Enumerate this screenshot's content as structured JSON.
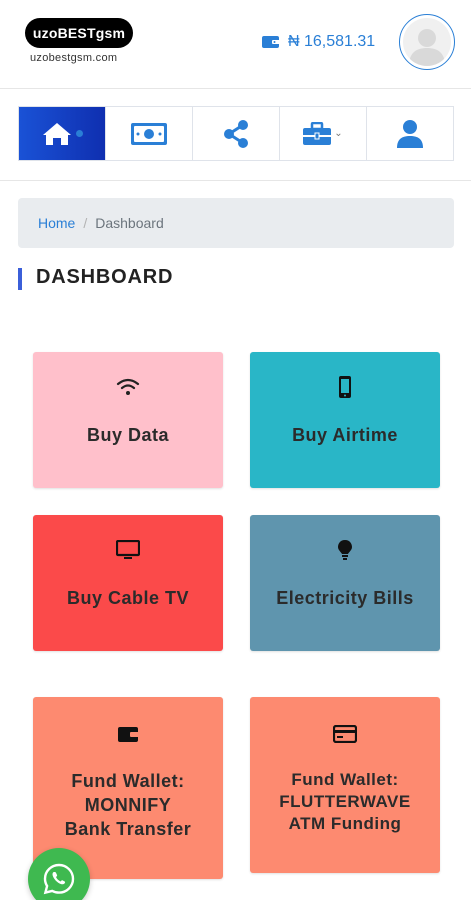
{
  "header": {
    "logo_text": "uzoBESTgsm",
    "logo_subtext": "uzobestgsm.com",
    "balance": "₦ 16,581.31"
  },
  "nav": {
    "items": [
      {
        "name": "home",
        "icon": "home-icon"
      },
      {
        "name": "money",
        "icon": "money-icon"
      },
      {
        "name": "share",
        "icon": "share-icon"
      },
      {
        "name": "briefcase",
        "icon": "briefcase-icon"
      },
      {
        "name": "profile",
        "icon": "user-icon"
      }
    ]
  },
  "breadcrumb": {
    "home": "Home",
    "separator": "/",
    "current": "Dashboard"
  },
  "page": {
    "title": "DASHBOARD"
  },
  "cards": [
    {
      "label": "Buy Data",
      "icon": "wifi-icon",
      "color": "#ffc0cb"
    },
    {
      "label": "Buy Airtime",
      "icon": "mobile-phone-icon",
      "color": "#29b6c7"
    },
    {
      "label": "Buy Cable TV",
      "icon": "tv-icon",
      "color": "#fb4a4a"
    },
    {
      "label": "Electricity Bills",
      "icon": "lightbulb-icon",
      "color": "#5f95ae"
    },
    {
      "label_lines": [
        "Fund Wallet:",
        "MONNIFY",
        "Bank Transfer"
      ],
      "icon": "wallet-icon",
      "color": "#fd8a70"
    },
    {
      "label_lines": [
        "Fund Wallet:",
        "FLUTTERWAVE",
        "ATM Funding"
      ],
      "icon": "credit-card-icon",
      "color": "#fd8a70"
    }
  ],
  "colors": {
    "accent": "#2a7fd6",
    "nav_active": "#1a52d6",
    "whatsapp": "#3fb950"
  }
}
